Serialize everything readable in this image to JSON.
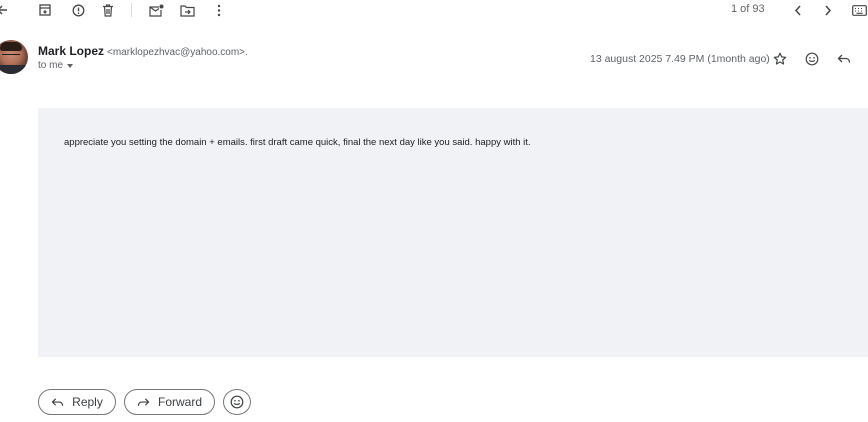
{
  "toolbar": {
    "pager": "1 of 93"
  },
  "message": {
    "sender_name": "Mark Lopez",
    "sender_email": "<marklopezhvac@yahoo.com>.",
    "recipient": "to me",
    "date": "13 august 2025 7.49 PM (1month ago)",
    "body": "appreciate you setting the domain + emails. first draft came quick, final the next day like you said. happy with it."
  },
  "actions": {
    "reply_label": "Reply",
    "forward_label": "Forward"
  }
}
